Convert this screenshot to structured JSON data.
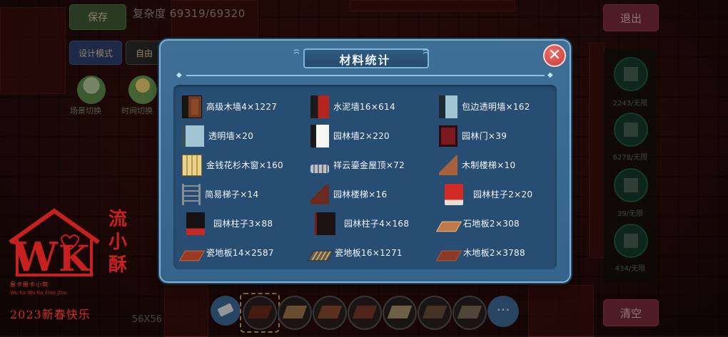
{
  "hud": {
    "save_label": "保存",
    "complexity": "复杂度 69319/69320",
    "exit_label": "退出",
    "design_mode_label": "设计模式",
    "free_mode_label": "自由",
    "scene_switch_label": "场景切换",
    "time_switch_label": "时间切换",
    "clear_label": "清空",
    "size_label": "56X56",
    "right_items": [
      {
        "count": "2243/无限"
      },
      {
        "count": "6278/无限"
      },
      {
        "count": "39/无限"
      },
      {
        "count": "434/无限"
      }
    ],
    "more_label": "···"
  },
  "palette": {
    "tile_colors": [
      "#6b2a1c",
      "#a07848",
      "#8a4a30",
      "#7a3a28",
      "#a8946a",
      "#6a4e3a",
      "#7a6a58"
    ]
  },
  "dialog": {
    "title": "材料统计",
    "close_label": "✕",
    "items": [
      {
        "label": "高级木墙4×1227",
        "icon": "wood-wall-icon"
      },
      {
        "label": "水泥墙16×614",
        "icon": "cement-wall-icon"
      },
      {
        "label": "包边透明墙×162",
        "icon": "edged-glass-wall-icon"
      },
      {
        "label": "透明墙×20",
        "icon": "glass-wall-icon"
      },
      {
        "label": "园林墙2×220",
        "icon": "garden-wall-icon"
      },
      {
        "label": "园林门×39",
        "icon": "garden-door-icon"
      },
      {
        "label": "金钱花杉木窗×160",
        "icon": "window-icon"
      },
      {
        "label": "祥云鎏金屋顶×72",
        "icon": "roof-icon"
      },
      {
        "label": "木制楼梯×10",
        "icon": "wooden-stairs-icon"
      },
      {
        "label": "简易梯子×14",
        "icon": "ladder-icon"
      },
      {
        "label": "园林楼梯×16",
        "icon": "garden-stairs-icon"
      },
      {
        "label": "园林柱子2×20",
        "icon": "garden-pillar-icon"
      },
      {
        "label": "园林柱子3×88",
        "icon": "garden-pillar-icon"
      },
      {
        "label": "园林柱子4×168",
        "icon": "garden-pillar-icon"
      },
      {
        "label": "石地板2×308",
        "icon": "stone-floor-icon"
      },
      {
        "label": "瓷地板14×2587",
        "icon": "tile-floor-icon"
      },
      {
        "label": "瓷地板16×1271",
        "icon": "tile-floor-icon"
      },
      {
        "label": "木地板2×3788",
        "icon": "wood-floor-icon"
      }
    ]
  },
  "watermark": {
    "vertical_text": "流小酥",
    "subtitle": "屋卡屋卡小筑",
    "subtitle_latin": "Wu Ka Wu Ka Xiao Zhu",
    "year_text": "2023新春快乐"
  }
}
